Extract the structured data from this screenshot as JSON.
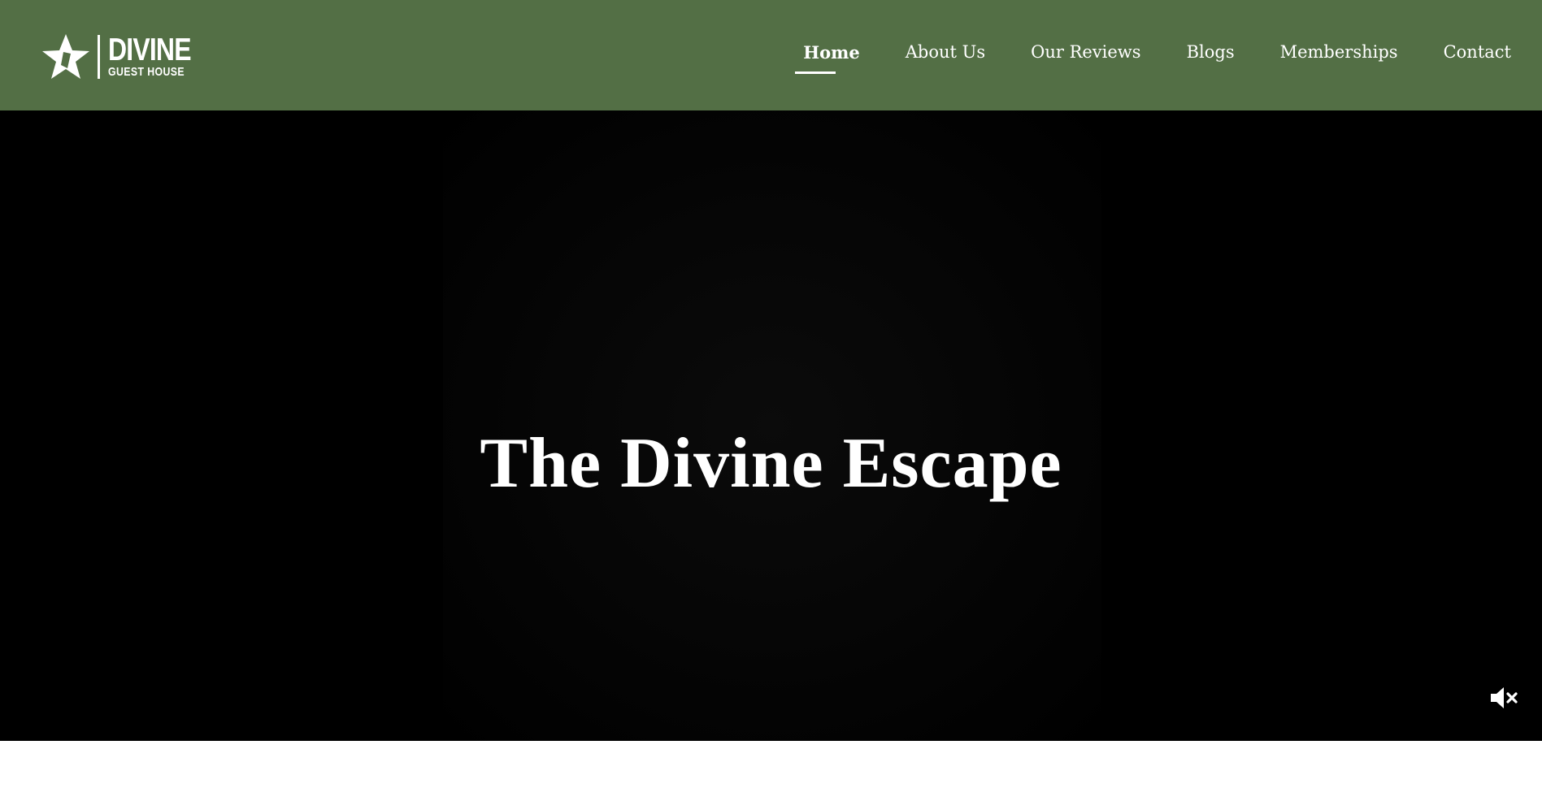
{
  "brand": {
    "name": "DIVINE",
    "subtitle": "GUEST HOUSE",
    "icon": "star-icon"
  },
  "nav": {
    "items": [
      {
        "label": "Home",
        "active": true
      },
      {
        "label": "About Us",
        "active": false
      },
      {
        "label": "Our Reviews",
        "active": false
      },
      {
        "label": "Blogs",
        "active": false
      },
      {
        "label": "Memberships",
        "active": false
      },
      {
        "label": "Contact",
        "active": false
      }
    ]
  },
  "hero": {
    "title": "The Divine Escape",
    "mute_icon": "volume-muted-icon"
  },
  "colors": {
    "header_bg": "#536f45",
    "hero_bg": "#000000",
    "text": "#ffffff"
  }
}
